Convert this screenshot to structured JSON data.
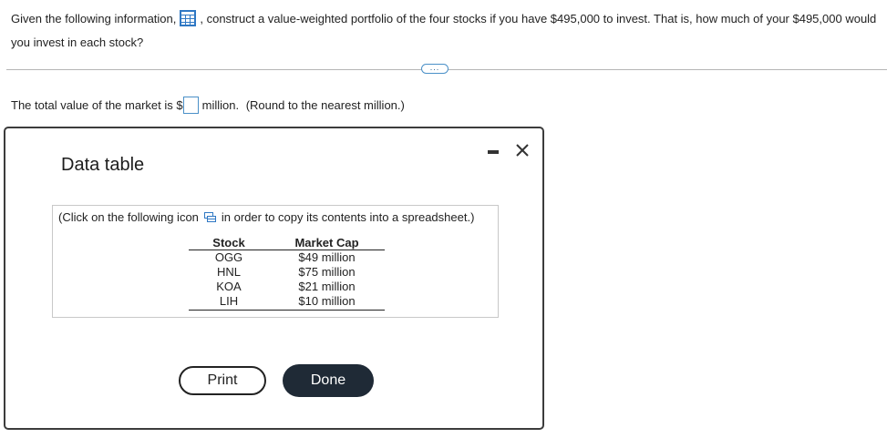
{
  "question": {
    "part1": "Given the following information,",
    "part2": ", construct a value-weighted portfolio of the four stocks if you have $495,000 to invest. That is, how much of your $495,000 would",
    "part3": "you invest in each stock?",
    "data_icon": "grid-table-icon"
  },
  "more_button": {
    "label": "..."
  },
  "answer": {
    "prefix": "The total value of the market is $",
    "input_value": "",
    "suffix": "million.",
    "note": "(Round to the nearest million.)"
  },
  "modal": {
    "title": "Data table",
    "minimize_icon": "minimize-icon",
    "close_icon": "close-icon",
    "instruction_before": "(Click on the following icon",
    "instruction_after": "in order to copy its contents into a spreadsheet.)",
    "copy_icon": "spreadsheet-copy-icon",
    "table": {
      "headers": [
        "Stock",
        "Market Cap"
      ],
      "rows": [
        [
          "OGG",
          "$49 million"
        ],
        [
          "HNL",
          "$75 million"
        ],
        [
          "KOA",
          "$21 million"
        ],
        [
          "LIH",
          "$10 million"
        ]
      ]
    },
    "print_label": "Print",
    "done_label": "Done"
  },
  "colors": {
    "accent": "#4a90c8",
    "done_button": "#1f2a36",
    "modal_border": "#3c3c3c"
  }
}
